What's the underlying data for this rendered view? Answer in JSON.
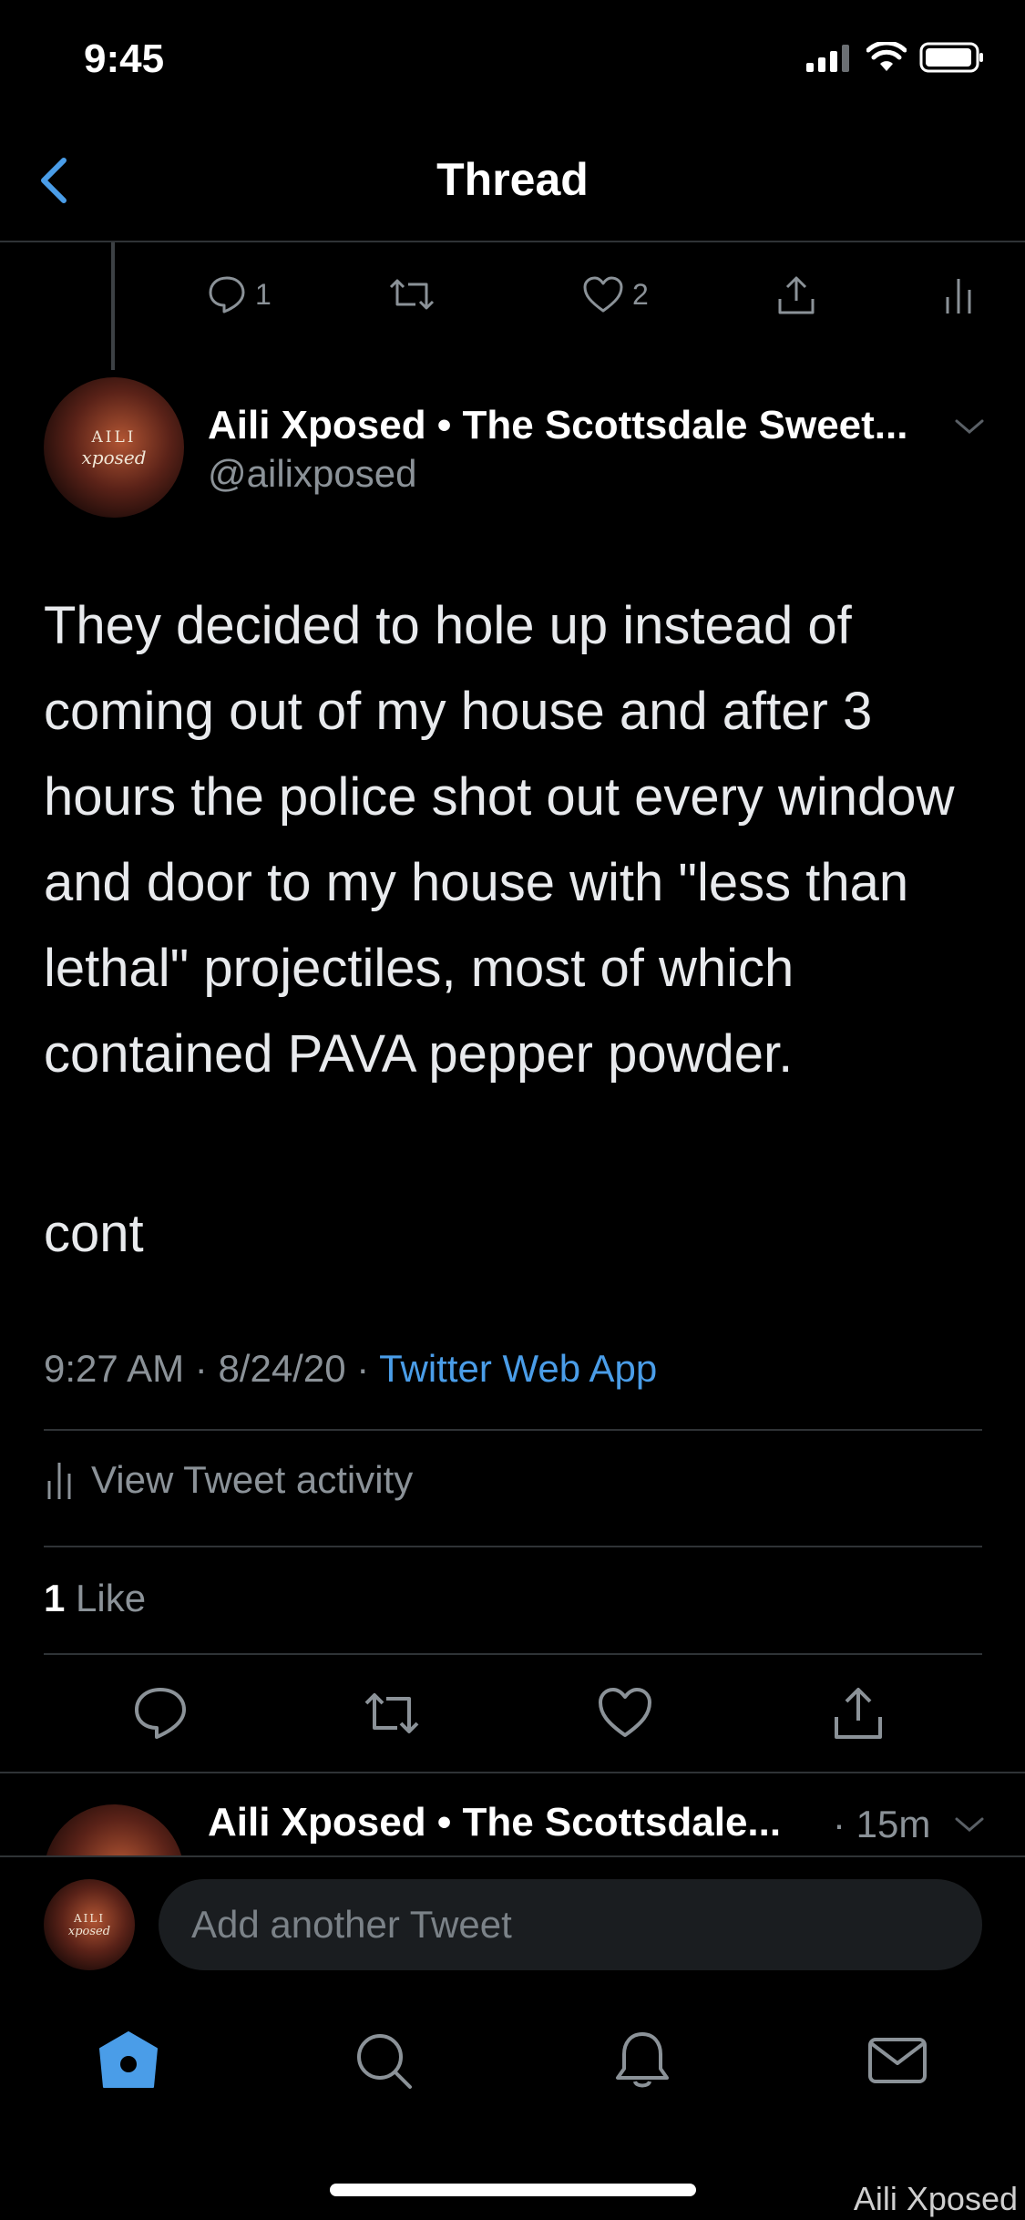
{
  "status_bar": {
    "time": "9:45"
  },
  "nav": {
    "title": "Thread"
  },
  "prev_tweet_actions": {
    "reply_count": "1",
    "like_count": "2"
  },
  "tweet": {
    "avatar_text_1": "AILI",
    "avatar_text_2": "xposed",
    "author_name": "Aili Xposed • The Scottsdale Sweet...",
    "author_handle": "@ailixposed",
    "paragraph_1": "They decided to hole up instead of coming out of my house and after 3 hours the police shot out every window and door to my house with \"less than lethal\" projectiles, most of which contained PAVA pepper powder.",
    "paragraph_2": "cont",
    "time": "9:27 AM",
    "date": "8/24/20",
    "source": "Twitter Web App",
    "activity_label": "View Tweet activity",
    "likes_count": "1",
    "likes_label": "Like"
  },
  "next_tweet": {
    "author_name": "Aili Xposed • The Scottsdale...",
    "time": "· 15m"
  },
  "compose": {
    "placeholder": "Add another Tweet"
  },
  "watermark": "Aili Xposed",
  "colors": {
    "accent": "#4a9de8",
    "muted": "#8b9298",
    "background": "#000000"
  }
}
